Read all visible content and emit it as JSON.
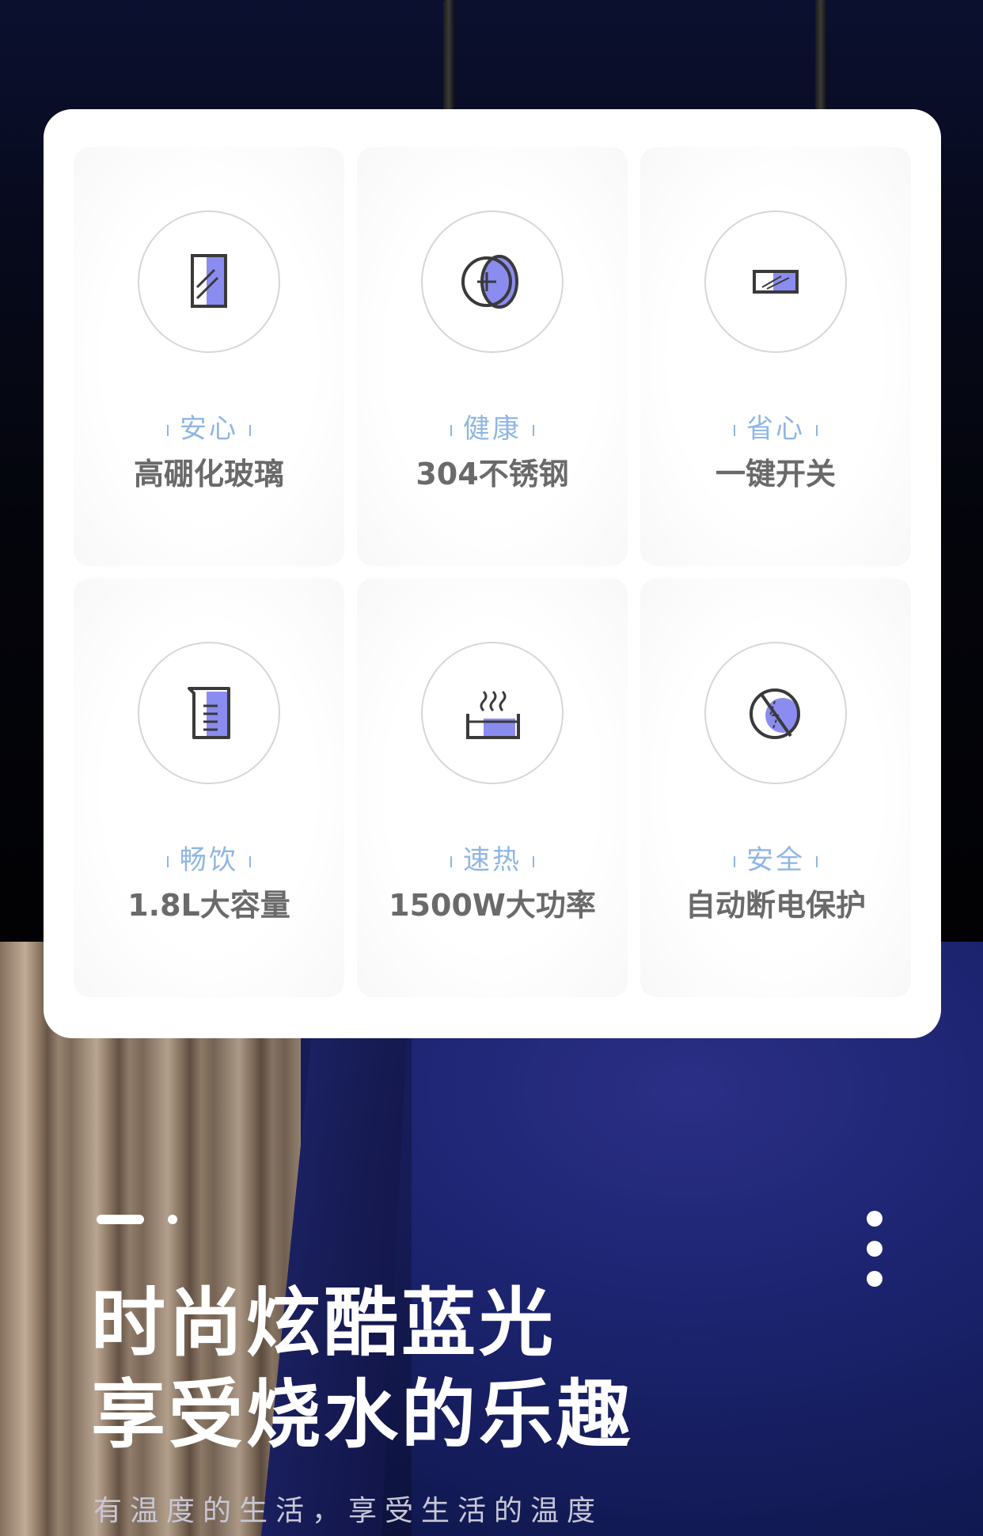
{
  "colors": {
    "accent_purple": "#8b8cf0",
    "title_blue": "#8fb6e4",
    "desc_gray": "#6a6a6a",
    "icon_stroke": "#3a3a3a"
  },
  "features": [
    {
      "icon": "glass-panel-icon",
      "title": "安心",
      "desc": "高硼化玻璃"
    },
    {
      "icon": "steel-layer-icon",
      "title": "健康",
      "desc": "304不锈钢"
    },
    {
      "icon": "switch-button-icon",
      "title": "省心",
      "desc": "一键开关"
    },
    {
      "icon": "beaker-icon",
      "title": "畅饮",
      "desc": "1.8L大容量"
    },
    {
      "icon": "heating-water-icon",
      "title": "速热",
      "desc": "1500W大功率"
    },
    {
      "icon": "power-off-protection-icon",
      "title": "安全",
      "desc": "自动断电保护"
    }
  ],
  "hero": {
    "title_line1": "时尚炫酷蓝光",
    "title_line2": "享受烧水的乐趣",
    "subtitle": "有温度的生活，享受生活的温度"
  }
}
